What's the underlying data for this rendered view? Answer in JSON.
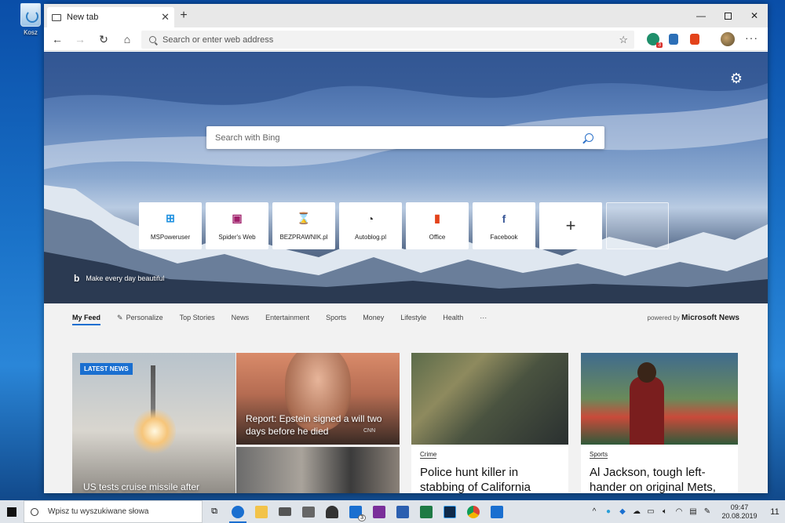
{
  "desktop": {
    "recycle_bin_label": "Kosz"
  },
  "browser": {
    "tab_title": "New tab",
    "address_placeholder": "Search or enter web address",
    "extension_badge": "3"
  },
  "hero": {
    "bing_placeholder": "Search with Bing",
    "tagline": "Make every day beautiful",
    "tiles": [
      {
        "label": "MSPoweruser",
        "icon": "windows-logo-icon",
        "color": "#1e90e0"
      },
      {
        "label": "Spider's Web",
        "icon": "spiders-web-icon",
        "color": "#a0206b"
      },
      {
        "label": "BEZPRAWNIK.pl",
        "icon": "bezprawnik-icon",
        "color": "#2a5fb8"
      },
      {
        "label": "Autoblog.pl",
        "icon": "autoblog-icon",
        "color": "#333333"
      },
      {
        "label": "Office",
        "icon": "office-icon",
        "color": "#e3431b"
      },
      {
        "label": "Facebook",
        "icon": "facebook-icon",
        "color": "#3b5998"
      }
    ]
  },
  "feed": {
    "tabs": [
      "My Feed",
      "Personalize",
      "Top Stories",
      "News",
      "Entertainment",
      "Sports",
      "Money",
      "Lifestyle",
      "Health"
    ],
    "more": "···",
    "powered_by": "powered by",
    "provider": "Microsoft News",
    "cards": {
      "latest_badge": "LATEST NEWS",
      "missile_title": "US tests cruise missile after",
      "epstein_title": "Report: Epstein signed a will two days before he died",
      "epstein_source": "CNN",
      "police_category": "Crime",
      "police_title": "Police hunt killer in stabbing of California",
      "jackson_category": "Sports",
      "jackson_title": "Al Jackson, tough left-hander on original Mets,"
    }
  },
  "taskbar": {
    "search_placeholder": "Wpisz tu wyszukiwane słowa",
    "time": "09:47",
    "date": "20.08.2019",
    "notification_count": "11",
    "mail_badge": "3"
  },
  "colors": {
    "accent": "#1a6fd0"
  }
}
